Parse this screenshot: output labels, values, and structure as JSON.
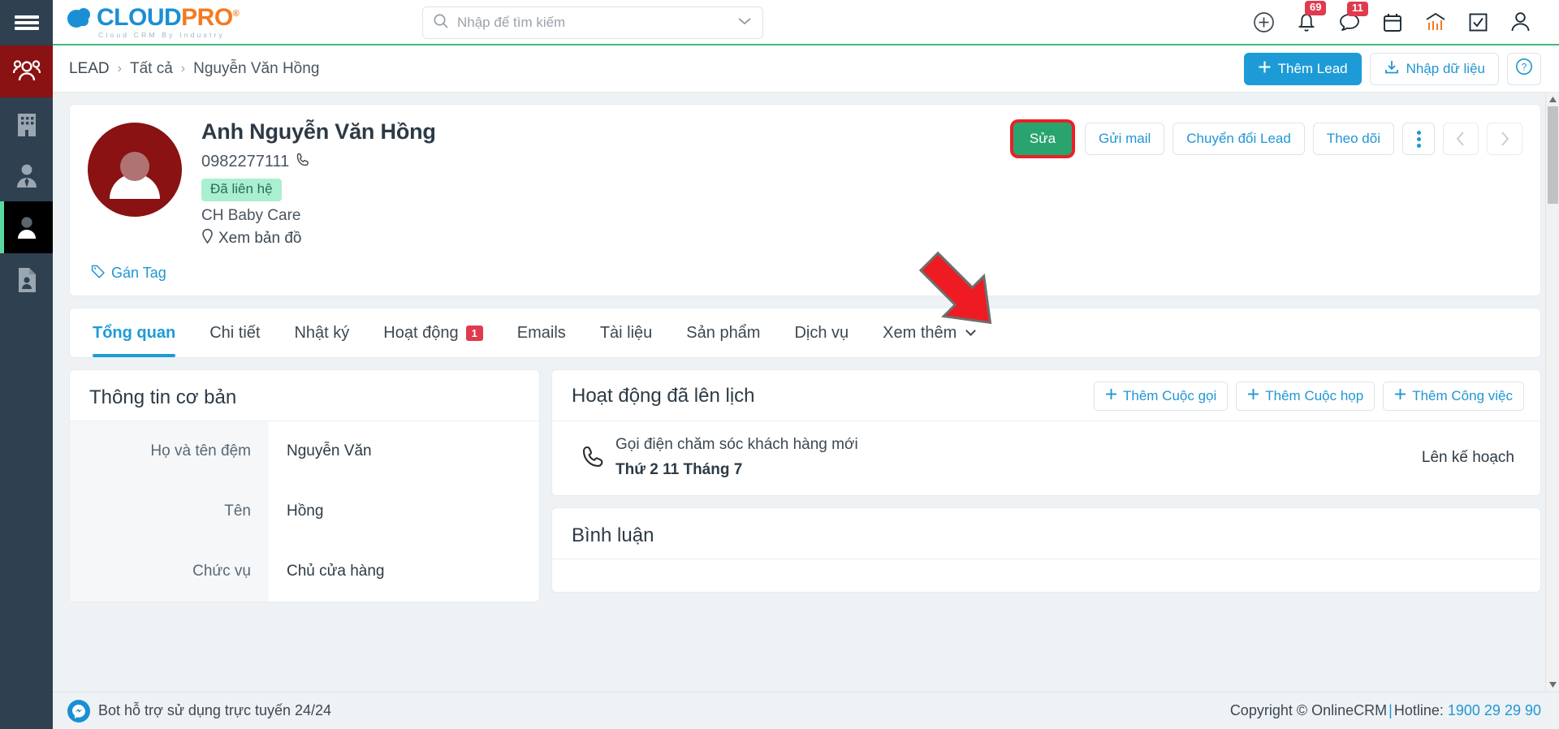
{
  "sidebar": {
    "menu_icon": "hamburger-icon",
    "items": [
      {
        "name": "group-icon",
        "state": "red"
      },
      {
        "name": "building-icon",
        "state": "normal"
      },
      {
        "name": "contact-tie-icon",
        "state": "normal"
      },
      {
        "name": "person-icon",
        "state": "current"
      },
      {
        "name": "document-person-icon",
        "state": "normal"
      }
    ]
  },
  "header": {
    "logo": {
      "cloud": "CLOUD",
      "pro": "PRO",
      "registered": "®",
      "tagline": "Cloud  CRM  By  Industry"
    },
    "search": {
      "placeholder": "Nhập để tìm kiếm",
      "value": "",
      "icon": "search-icon",
      "dropdown_icon": "chevron-down-icon"
    },
    "icons": [
      {
        "name": "plus-circle-icon",
        "badge": ""
      },
      {
        "name": "bell-icon",
        "badge": "69"
      },
      {
        "name": "chat-bubble-icon",
        "badge": "11"
      },
      {
        "name": "calendar-icon",
        "badge": ""
      },
      {
        "name": "analytics-icon",
        "badge": ""
      },
      {
        "name": "checkbox-icon",
        "badge": ""
      },
      {
        "name": "user-account-icon",
        "badge": ""
      }
    ]
  },
  "breadcrumb": {
    "items": [
      "LEAD",
      "Tất cả",
      "Nguyễn Văn Hồng"
    ],
    "separator": "›",
    "actions": {
      "add_lead": "Thêm Lead",
      "import": "Nhập dữ liệu",
      "help": "?"
    }
  },
  "profile": {
    "name": "Anh Nguyễn Văn Hồng",
    "phone": "0982277111",
    "phone_icon": "phone-icon",
    "status": "Đã liên hệ",
    "company": "CH Baby Care",
    "map_link": "Xem bản đồ",
    "map_icon": "location-pin-icon",
    "tag_link": "Gán Tag",
    "tag_icon": "tag-icon",
    "actions": {
      "edit": "Sửa",
      "send_mail": "Gửi mail",
      "convert_lead": "Chuyển đổi Lead",
      "follow": "Theo dõi",
      "more_icon": "vertical-dots-icon",
      "prev_icon": "chevron-left-icon",
      "next_icon": "chevron-right-icon"
    },
    "highlight_color": "#ea2027",
    "edit_color": "#2aa46f",
    "status_bg": "#a9f0d1"
  },
  "tabs": [
    {
      "label": "Tổng quan",
      "badge": "",
      "active": true
    },
    {
      "label": "Chi tiết",
      "badge": "",
      "active": false
    },
    {
      "label": "Nhật ký",
      "badge": "",
      "active": false
    },
    {
      "label": "Hoạt động",
      "badge": "1",
      "active": false
    },
    {
      "label": "Emails",
      "badge": "",
      "active": false
    },
    {
      "label": "Tài liệu",
      "badge": "",
      "active": false
    },
    {
      "label": "Sản phẩm",
      "badge": "",
      "active": false
    },
    {
      "label": "Dịch vụ",
      "badge": "",
      "active": false
    },
    {
      "label": "Xem thêm",
      "badge": "",
      "active": false,
      "has_chevron": true
    }
  ],
  "basic_info": {
    "title": "Thông tin cơ bản",
    "rows": [
      {
        "label": "Họ và tên đệm",
        "value": "Nguyễn Văn"
      },
      {
        "label": "Tên",
        "value": "Hồng"
      },
      {
        "label": "Chức vụ",
        "value": "Chủ cửa hàng"
      }
    ]
  },
  "scheduled": {
    "title": "Hoạt động đã lên lịch",
    "buttons": [
      {
        "label": "Thêm Cuộc gọi"
      },
      {
        "label": "Thêm Cuộc họp"
      },
      {
        "label": "Thêm Công việc"
      }
    ],
    "items": [
      {
        "icon": "phone-call-icon",
        "title": "Gọi điện chăm sóc khách hàng mới",
        "date": "Thứ 2 11 Tháng 7",
        "status": "Lên kế hoạch"
      }
    ]
  },
  "comments": {
    "title": "Bình luận"
  },
  "footer": {
    "bot_text": "Bot hỗ trợ sử dụng trực tuyến 24/24",
    "bot_icon": "messenger-icon",
    "copyright": "Copyright © OnlineCRM",
    "pipe": "|",
    "hotline_label": "Hotline:",
    "hotline": "1900 29 29 90"
  }
}
